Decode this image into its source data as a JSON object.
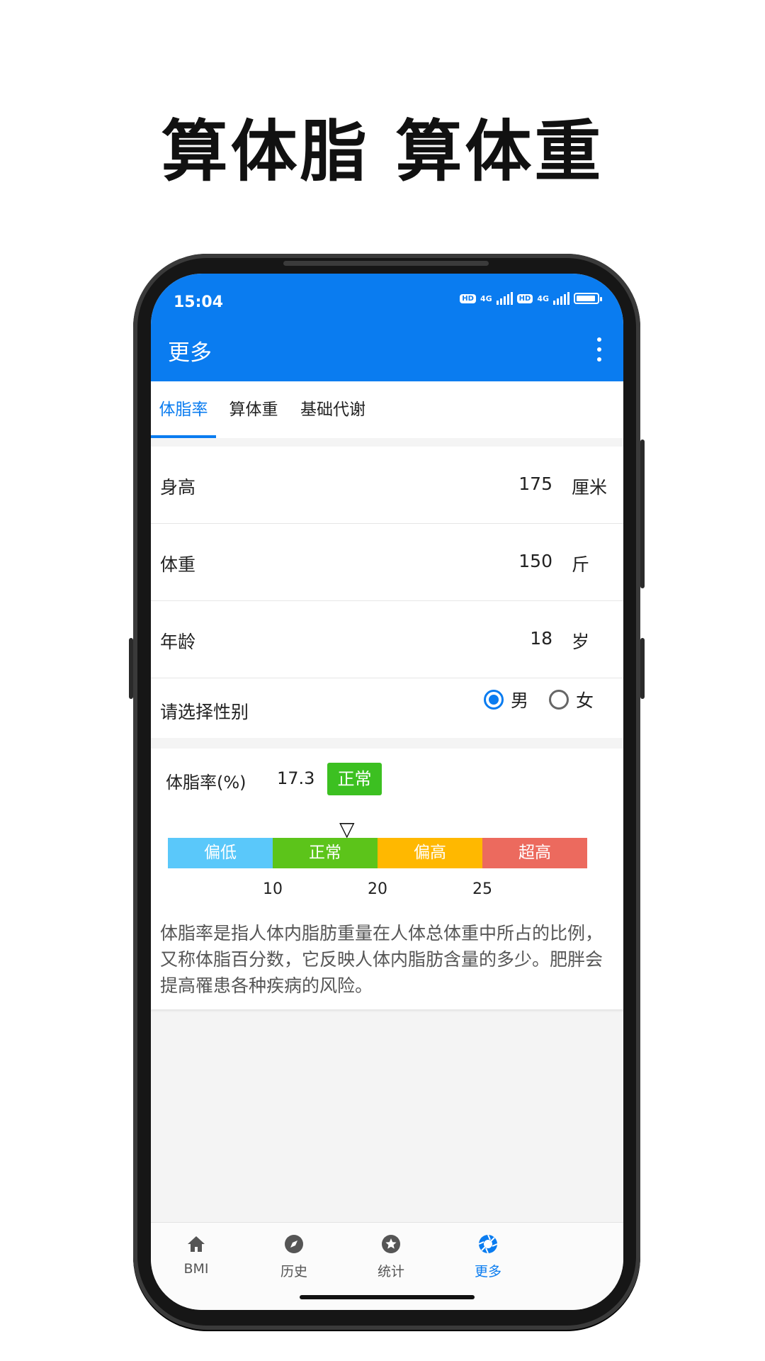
{
  "headline": "算体脂 算体重",
  "status_bar": {
    "time": "15:04",
    "network1": "4G",
    "network2": "4G",
    "hd": "HD"
  },
  "app_bar": {
    "title": "更多"
  },
  "tabs": [
    {
      "label": "体脂率",
      "active": true
    },
    {
      "label": "算体重",
      "active": false
    },
    {
      "label": "基础代谢",
      "active": false
    }
  ],
  "form": {
    "height": {
      "label": "身高",
      "value": "175",
      "unit": "厘米"
    },
    "weight": {
      "label": "体重",
      "value": "150",
      "unit": "斤"
    },
    "age": {
      "label": "年龄",
      "value": "18",
      "unit": "岁"
    },
    "gender": {
      "label": "请选择性别",
      "options": [
        "男",
        "女"
      ],
      "selected": "男"
    }
  },
  "result": {
    "label": "体脂率(%)",
    "value": "17.3",
    "status": "正常",
    "status_color": "#3cc021",
    "marker": "▽",
    "scale": [
      {
        "label": "偏低",
        "color": "#5ac8fa"
      },
      {
        "label": "正常",
        "color": "#5cc41a"
      },
      {
        "label": "偏高",
        "color": "#ffb800"
      },
      {
        "label": "超高",
        "color": "#ec6a5e"
      }
    ],
    "ticks": [
      "10",
      "20",
      "25"
    ],
    "description": "体脂率是指人体内脂肪重量在人体总体重中所占的比例，又称体脂百分数，它反映人体内脂肪含量的多少。肥胖会提高罹患各种疾病的风险。"
  },
  "bottom_nav": [
    {
      "label": "BMI",
      "icon": "home-icon",
      "active": false
    },
    {
      "label": "历史",
      "icon": "compass-icon",
      "active": false
    },
    {
      "label": "统计",
      "icon": "star-icon",
      "active": false
    },
    {
      "label": "更多",
      "icon": "aperture-icon",
      "active": true
    }
  ],
  "colors": {
    "primary": "#0a7cf0",
    "accent_green": "#3cc021"
  }
}
